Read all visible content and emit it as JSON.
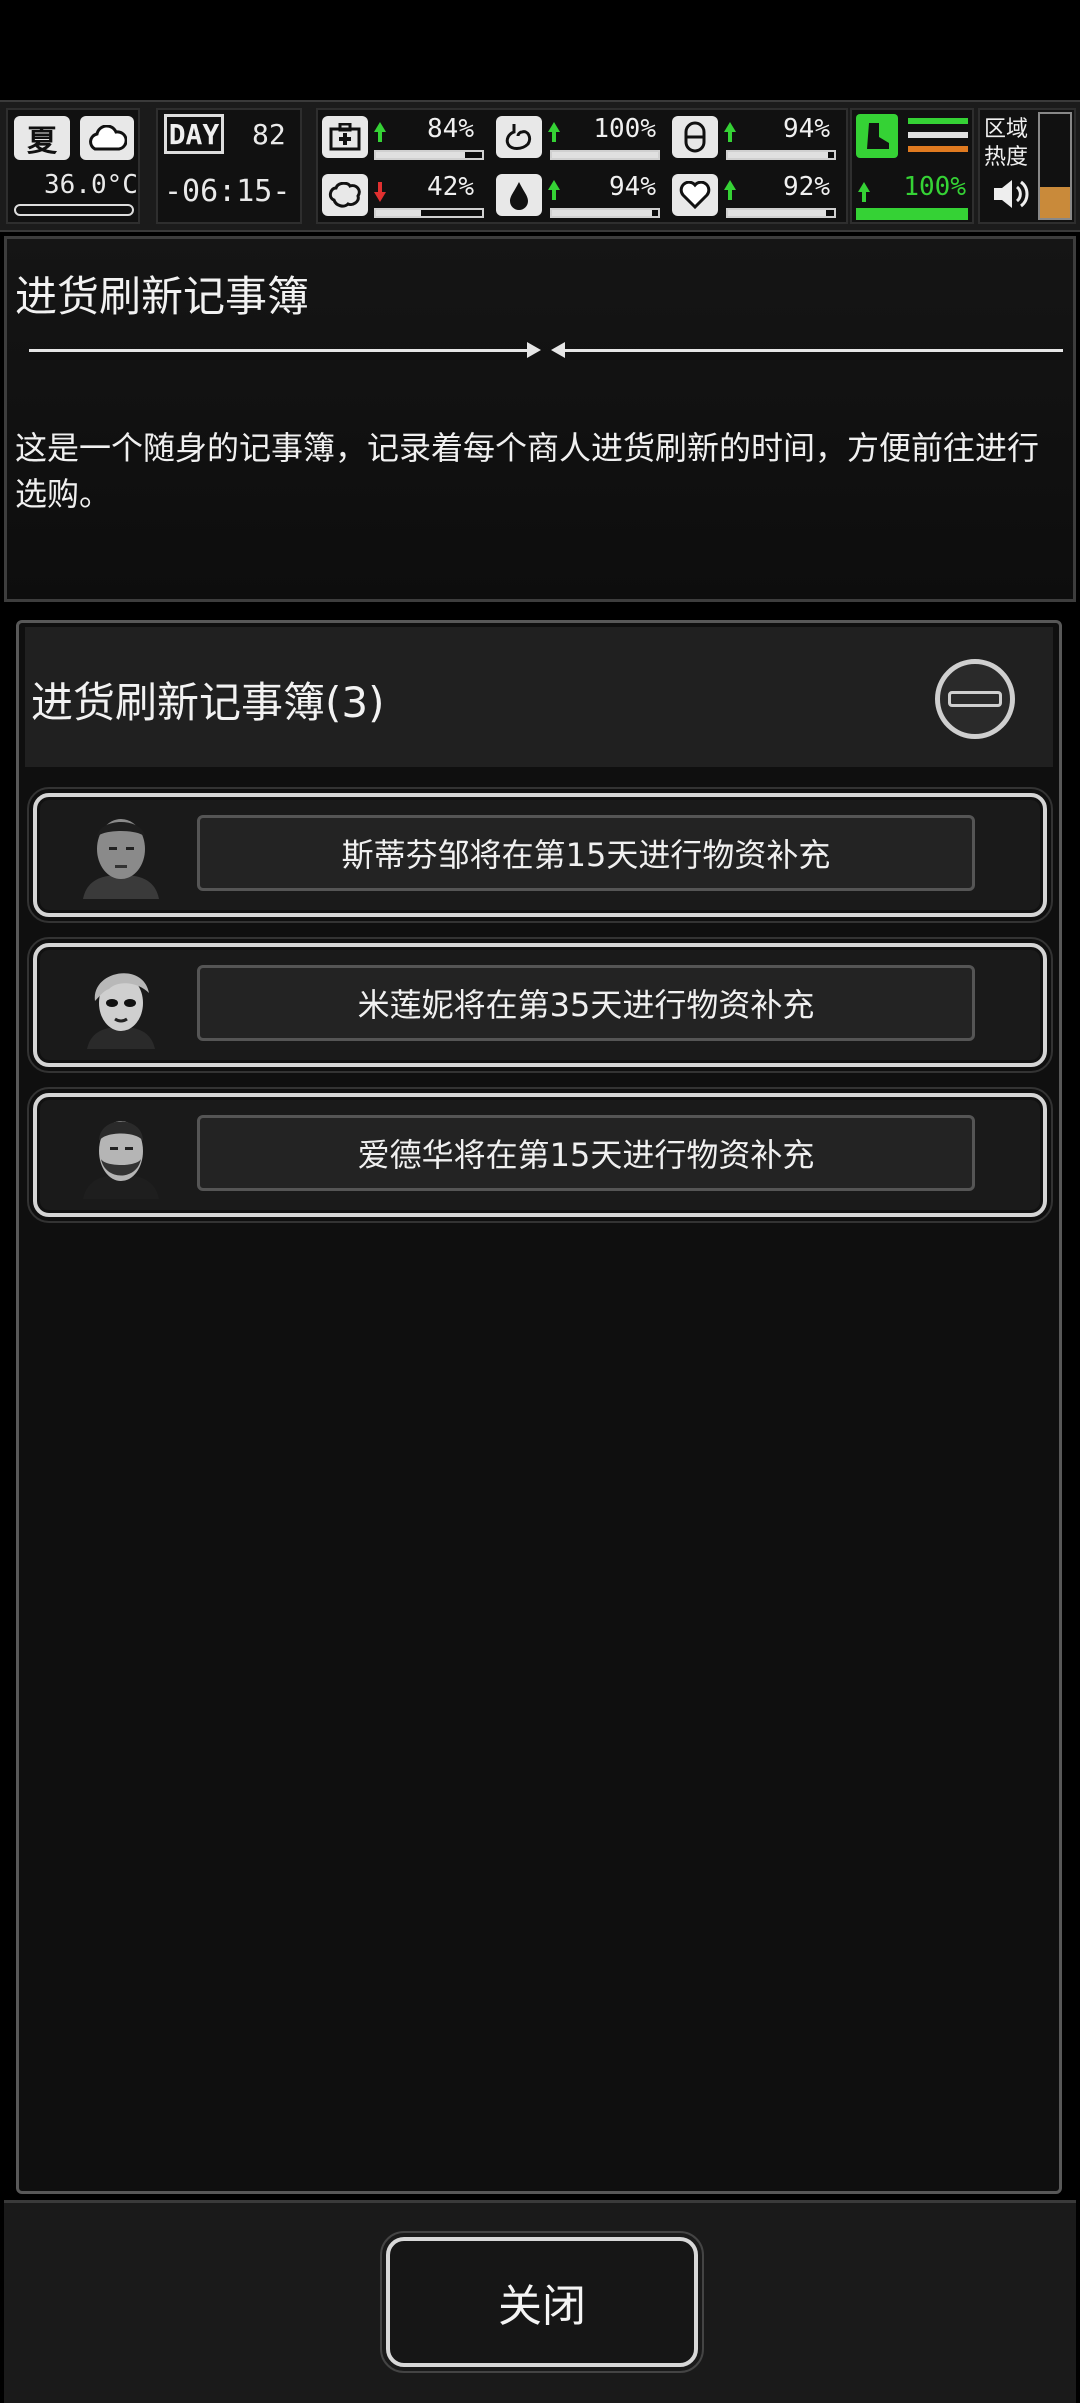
{
  "hud": {
    "season": "夏",
    "temperature": "36.0°C",
    "day_label": "DAY",
    "day_value": "82",
    "time": "-06:15-",
    "stats": {
      "health": {
        "value": "84%",
        "fill": 0.84,
        "trend": "up"
      },
      "stomach": {
        "value": "100%",
        "fill": 1.0,
        "trend": "up"
      },
      "pill": {
        "value": "94%",
        "fill": 0.94,
        "trend": "up"
      },
      "brain": {
        "value": "42%",
        "fill": 0.42,
        "trend": "down"
      },
      "water": {
        "value": "94%",
        "fill": 0.94,
        "trend": "up"
      },
      "heart": {
        "value": "92%",
        "fill": 0.92,
        "trend": "up"
      },
      "stamina": {
        "value": "100%",
        "fill": 1.0,
        "trend": "up"
      }
    },
    "zone_label": "区域热度",
    "zone_heat_fill": 0.3,
    "colors": {
      "accent_green": "#35d235",
      "down_red": "#e03030",
      "heat_orange": "#c98a3a"
    }
  },
  "info": {
    "title": "进货刷新记事簿",
    "description": "这是一个随身的记事簿，记录着每个商人进货刷新的时间，方便前往进行选购。"
  },
  "list": {
    "title": "进货刷新记事簿(3)",
    "items": [
      {
        "label": "斯蒂芬邹将在第15天进行物资补充"
      },
      {
        "label": "米莲妮将在第35天进行物资补充"
      },
      {
        "label": "爱德华将在第15天进行物资补充"
      }
    ]
  },
  "footer": {
    "close_label": "关闭"
  }
}
